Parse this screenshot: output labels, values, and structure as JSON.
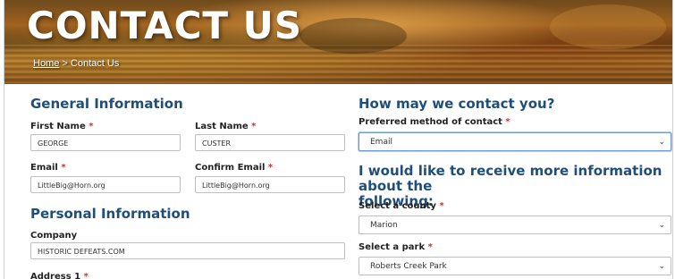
{
  "hero": {
    "title": "CONTACT US",
    "breadcrumb_home": "Home",
    "breadcrumb_sep": " > ",
    "breadcrumb_current": "Contact Us"
  },
  "general": {
    "heading": "General Information",
    "first_name_label": "First Name",
    "first_name_value": "GEORGE",
    "last_name_label": "Last Name",
    "last_name_value": "CUSTER",
    "email_label": "Email",
    "email_value": "LittleBig@Horn.org",
    "confirm_email_label": "Confirm Email",
    "confirm_email_value": "LittleBig@Horn.org"
  },
  "personal": {
    "heading": "Personal Information",
    "company_label": "Company",
    "company_value": "HISTORIC DEFEATS.COM",
    "address_label": "Address 1"
  },
  "contact": {
    "heading": "How may we contact you?",
    "method_label": "Preferred method of contact",
    "method_value": "Email"
  },
  "info": {
    "heading_line1": "I would like to receive more information about the",
    "heading_line2": "following:",
    "county_label": "Select a county",
    "county_value": "Marion",
    "park_label": "Select a park",
    "park_value": "Roberts Creek Park"
  },
  "required_mark": "*",
  "colors": {
    "heading": "#1f4e7a",
    "required": "#c0392b",
    "focus": "#6b9bd1"
  },
  "icons": {
    "select_arrow": "chevron-down-icon"
  }
}
